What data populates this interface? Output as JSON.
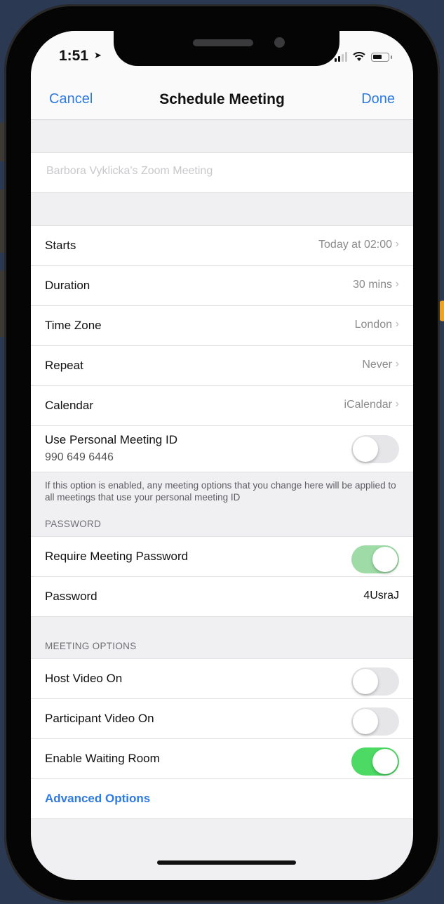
{
  "status": {
    "time": "1:51"
  },
  "nav": {
    "cancel": "Cancel",
    "title": "Schedule Meeting",
    "done": "Done"
  },
  "topic": {
    "placeholder": "Barbora Vyklicka's Zoom Meeting",
    "value": ""
  },
  "schedule": [
    {
      "label": "Starts",
      "value": "Today at 02:00"
    },
    {
      "label": "Duration",
      "value": "30 mins"
    },
    {
      "label": "Time Zone",
      "value": "London"
    },
    {
      "label": "Repeat",
      "value": "Never"
    },
    {
      "label": "Calendar",
      "value": "iCalendar"
    }
  ],
  "personal_id": {
    "label": "Use Personal Meeting ID",
    "id": "990 649 6446",
    "enabled": false,
    "note": "If this option is enabled, any meeting options that you change here will be applied to all meetings that use your personal meeting ID"
  },
  "password_section": {
    "header": "PASSWORD",
    "require_label": "Require Meeting Password",
    "require_enabled": true,
    "password_label": "Password",
    "password_value": "4UsraJ"
  },
  "meeting_options": {
    "header": "MEETING OPTIONS",
    "items": [
      {
        "label": "Host Video On",
        "enabled": false
      },
      {
        "label": "Participant Video On",
        "enabled": false
      },
      {
        "label": "Enable Waiting Room",
        "enabled": true
      }
    ],
    "advanced_label": "Advanced Options"
  },
  "colors": {
    "accent": "#2d7ae2",
    "toggle_on": "#4cd964",
    "toggle_on_disabled": "#9edba6"
  },
  "icons": [
    "location-arrow-icon",
    "signal-icon",
    "wifi-icon",
    "battery-icon",
    "chevron-right-icon"
  ]
}
